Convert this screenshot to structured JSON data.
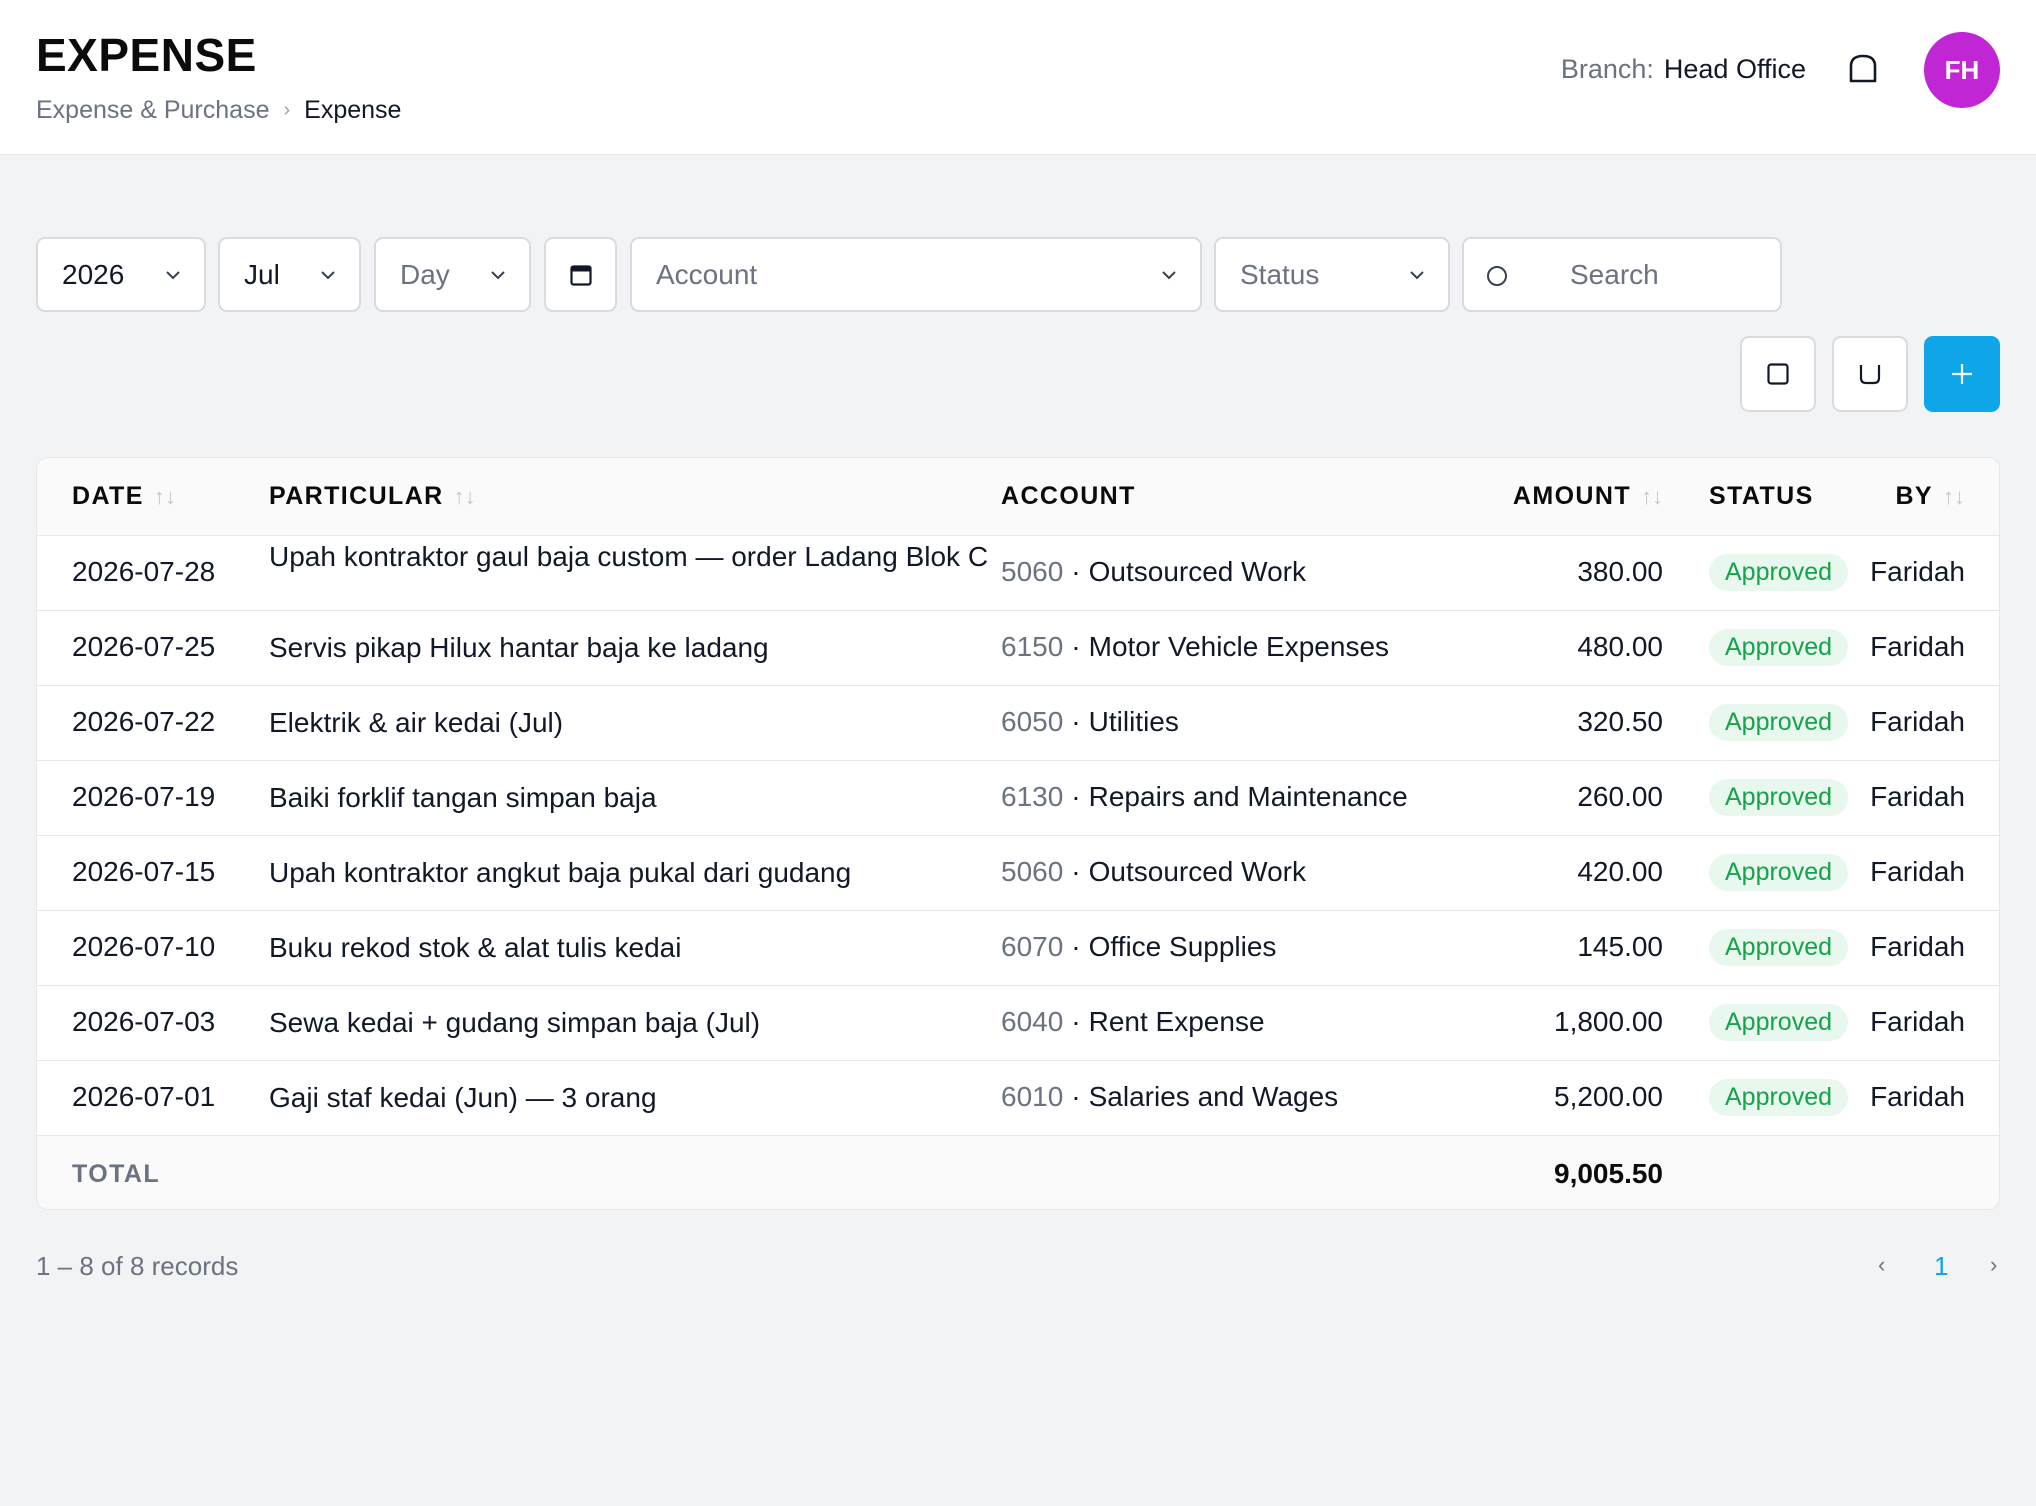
{
  "header": {
    "title": "EXPENSE",
    "breadcrumb": [
      "Expense & Purchase",
      "Expense"
    ],
    "breadcrumb_sep": "›",
    "branch_label": "Branch:",
    "branch_value": "Head Office",
    "avatar_initials": "FH",
    "avatar_color": "#c026d3"
  },
  "filters": {
    "year": "2026",
    "month": "Jul",
    "day_placeholder": "Day",
    "account_placeholder": "Account",
    "status_placeholder": "Status",
    "search_placeholder": "Search"
  },
  "toolbar": {
    "add_label": "+",
    "add_color": "#0ea5e9"
  },
  "table": {
    "columns": {
      "date": "DATE",
      "particular": "PARTICULAR",
      "account": "ACCOUNT",
      "amount": "AMOUNT",
      "status": "STATUS",
      "by": "BY"
    },
    "sort_glyph": "↑↓",
    "rows": [
      {
        "date": "2026-07-28",
        "particular": "Upah kontraktor gaul baja custom — order Ladang Blok C",
        "code": "5060",
        "account": "Outsourced Work",
        "amount": "380.00",
        "status": "Approved",
        "by": "Faridah"
      },
      {
        "date": "2026-07-25",
        "particular": "Servis pikap Hilux hantar baja ke ladang",
        "code": "6150",
        "account": "Motor Vehicle Expenses",
        "amount": "480.00",
        "status": "Approved",
        "by": "Faridah"
      },
      {
        "date": "2026-07-22",
        "particular": "Elektrik & air kedai (Jul)",
        "code": "6050",
        "account": "Utilities",
        "amount": "320.50",
        "status": "Approved",
        "by": "Faridah"
      },
      {
        "date": "2026-07-19",
        "particular": "Baiki forklif tangan simpan baja",
        "code": "6130",
        "account": "Repairs and Maintenance",
        "amount": "260.00",
        "status": "Approved",
        "by": "Faridah"
      },
      {
        "date": "2026-07-15",
        "particular": "Upah kontraktor angkut baja pukal dari gudang",
        "code": "5060",
        "account": "Outsourced Work",
        "amount": "420.00",
        "status": "Approved",
        "by": "Faridah"
      },
      {
        "date": "2026-07-10",
        "particular": "Buku rekod stok & alat tulis kedai",
        "code": "6070",
        "account": "Office Supplies",
        "amount": "145.00",
        "status": "Approved",
        "by": "Faridah"
      },
      {
        "date": "2026-07-03",
        "particular": "Sewa kedai + gudang simpan baja (Jul)",
        "code": "6040",
        "account": "Rent Expense",
        "amount": "1,800.00",
        "status": "Approved",
        "by": "Faridah"
      },
      {
        "date": "2026-07-01",
        "particular": "Gaji staf kedai (Jun) — 3 orang",
        "code": "6010",
        "account": "Salaries and Wages",
        "amount": "5,200.00",
        "status": "Approved",
        "by": "Faridah"
      }
    ],
    "total_label": "TOTAL",
    "total_value": "9,005.50",
    "status_color": "#16a34a"
  },
  "pagination": {
    "records_text": "1 – 8 of 8 records",
    "prev": "‹",
    "current_page": "1",
    "next": "›"
  }
}
